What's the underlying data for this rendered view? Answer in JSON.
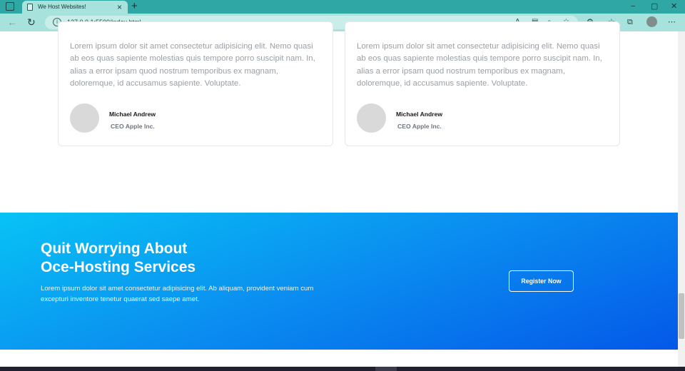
{
  "browser": {
    "tab_title": "We Host Websites!",
    "tab_close": "×",
    "new_tab": "+",
    "url": "127.0.0.1:5500/index.html",
    "window_controls": {
      "minimize": "−",
      "maximize": "▢",
      "close": "✕"
    },
    "icons": [
      "back-arrow-icon",
      "refresh-icon",
      "info-icon",
      "read-aloud-icon",
      "immersive-reader-icon",
      "zoom-icon",
      "favorite-add-icon",
      "extensions-icon",
      "favorites-icon",
      "collections-icon",
      "profile-icon",
      "more-menu-icon"
    ]
  },
  "testimonials": [
    {
      "text": "Lorem ipsum dolor sit amet consectetur adipisicing elit. Nemo quasi ab eos quas sapiente molestias quis tempore porro suscipit nam. In, alias a error ipsam quod nostrum temporibus ex magnam, doloremque, id accusamus sapiente. Voluptate.",
      "name": "Michael Andrew",
      "role": "CEO Apple Inc."
    },
    {
      "text": "Lorem ipsum dolor sit amet consectetur adipisicing elit. Nemo quasi ab eos quas sapiente molestias quis tempore porro suscipit nam. In, alias a error ipsam quod nostrum temporibus ex magnam, doloremque, id accusamus sapiente. Voluptate.",
      "name": "Michael Andrew",
      "role": "CEO Apple Inc."
    }
  ],
  "cta": {
    "title_line1": "Quit Worrying About",
    "title_line2": "Oce-Hosting Services",
    "text": "Lorem ipsum dolor sit amet consectetur adipisicing elit. Ab aliquam, provident veniam cum excepturi inventore tenetur quaerat sed saepe amet.",
    "button": "Register Now"
  },
  "colors": {
    "accent_start": "#08c3f5",
    "accent_end": "#0458e8",
    "chrome": "#2fa7a5"
  }
}
